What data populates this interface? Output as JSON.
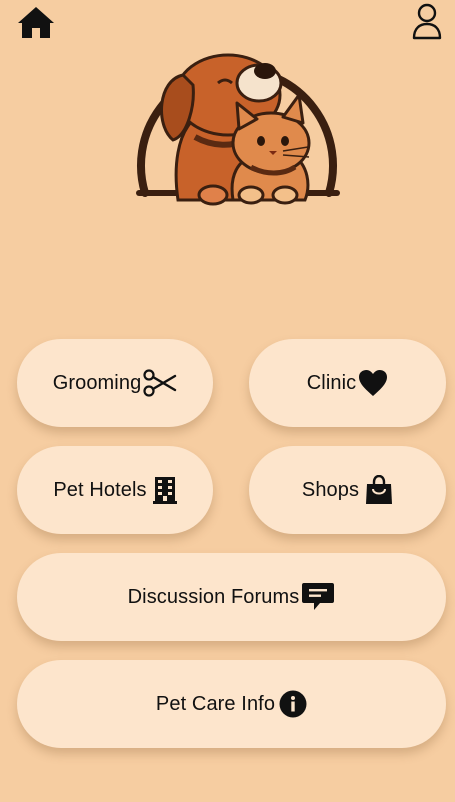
{
  "header": {
    "home_icon": "home-icon",
    "profile_icon": "user-profile-icon"
  },
  "logo": {
    "description_icon": "dog-and-cat-logo"
  },
  "menu": {
    "grooming": {
      "label": "Grooming",
      "icon": "scissors-icon"
    },
    "clinic": {
      "label": "Clinic",
      "icon": "heart-icon"
    },
    "pet_hotels": {
      "label": "Pet Hotels",
      "icon": "building-icon"
    },
    "shops": {
      "label": "Shops",
      "icon": "shopping-bag-icon"
    },
    "forums": {
      "label": "Discussion Forums",
      "icon": "chat-bubble-icon"
    },
    "care_info": {
      "label": "Pet Care Info",
      "icon": "info-icon"
    }
  },
  "colors": {
    "background": "#f6cda1",
    "button": "#fde5cc",
    "logo_brown": "#3a1f10",
    "dog_orange": "#c8622a",
    "cat_orange": "#e08a4c"
  }
}
